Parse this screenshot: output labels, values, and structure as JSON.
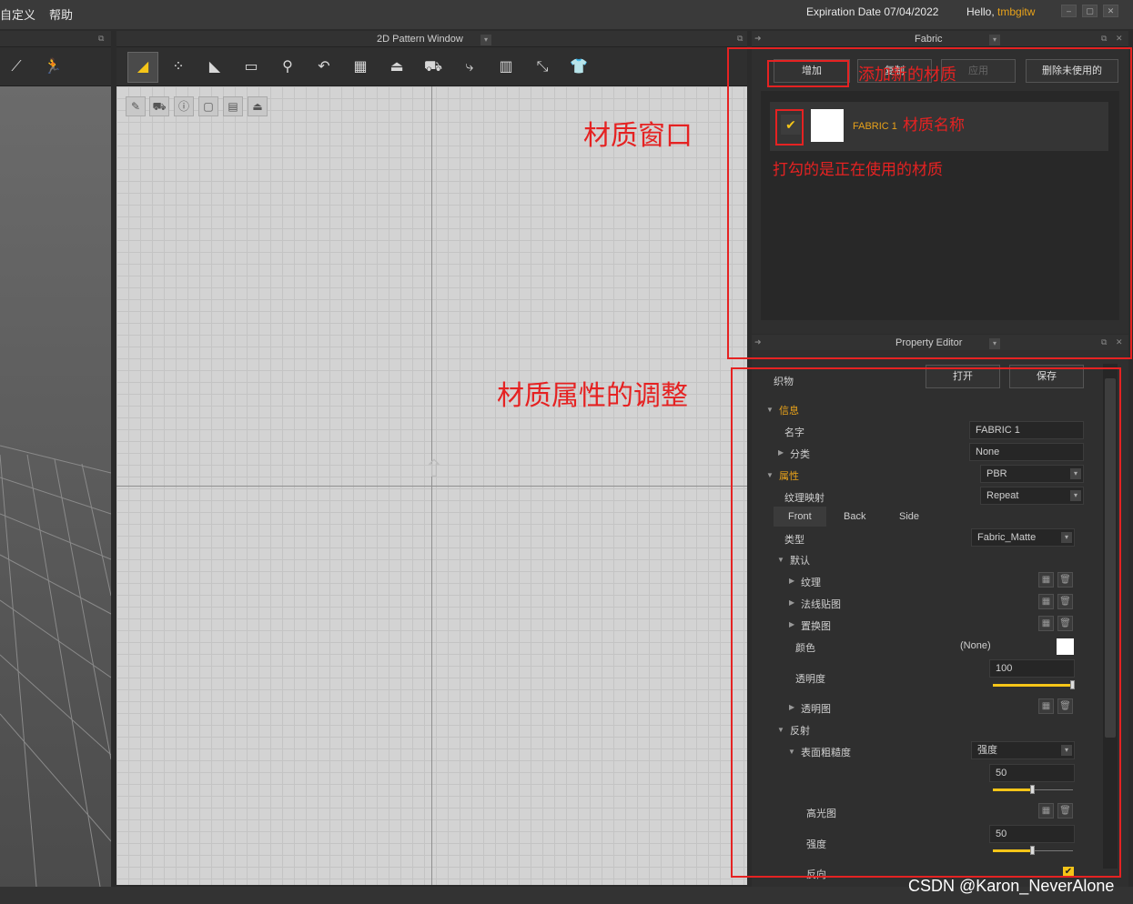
{
  "menu": {
    "items": [
      "自定义",
      "帮助"
    ]
  },
  "header": {
    "expiration": "Expiration Date 07/04/2022",
    "hello_prefix": "Hello,",
    "user": "tmbgitw"
  },
  "window_controls": [
    "–",
    "▢",
    "✕"
  ],
  "pattern_window": {
    "title": "2D Pattern Window"
  },
  "fabric_panel": {
    "title": "Fabric",
    "buttons": {
      "add": "增加",
      "copy": "复制",
      "apply": "应用",
      "delete_unused": "删除未使用的"
    },
    "items": [
      {
        "name": "FABRIC 1",
        "checked": true,
        "swatch_color": "#ffffff"
      }
    ]
  },
  "property_editor": {
    "title": "Property Editor",
    "section_label": "织物",
    "open_button": "打开",
    "save_button": "保存",
    "info_label": "信息",
    "name_label": "名字",
    "name_value": "FABRIC 1",
    "category_label": "分类",
    "category_value": "None",
    "attributes_label": "属性",
    "attributes_value": "PBR",
    "texture_mapping_label": "纹理映射",
    "texture_mapping_value": "Repeat",
    "tabs": [
      "Front",
      "Back",
      "Side"
    ],
    "type_label": "类型",
    "type_value": "Fabric_Matte",
    "default_label": "默认",
    "texture_label": "纹理",
    "normal_map_label": "法线贴图",
    "displacement_label": "置换图",
    "color_label": "颜色",
    "color_value": "(None)",
    "color_swatch": "#ffffff",
    "opacity_label": "透明度",
    "opacity_value": "100",
    "opacity_fraction": 1.0,
    "opacity_map_label": "透明图",
    "reflection_label": "反射",
    "roughness_label": "表面粗糙度",
    "roughness_mode": "强度",
    "roughness_value": "50",
    "roughness_fraction": 0.5,
    "gloss_map_label": "高光图",
    "intensity_label": "强度",
    "intensity_value": "50",
    "intensity_fraction": 0.5,
    "last_label": "反向"
  },
  "annotations": {
    "add_material": "添加新的材质",
    "material_window": "材质窗口",
    "material_name": "材质名称",
    "checked_note": "打勾的是正在使用的材质",
    "property_adjust": "材质属性的调整"
  },
  "watermark": "CSDN @Karon_NeverAlone",
  "colors": {
    "accent": "#f5c518",
    "annotation": "#e52222",
    "orange_text": "#e8a21a"
  }
}
